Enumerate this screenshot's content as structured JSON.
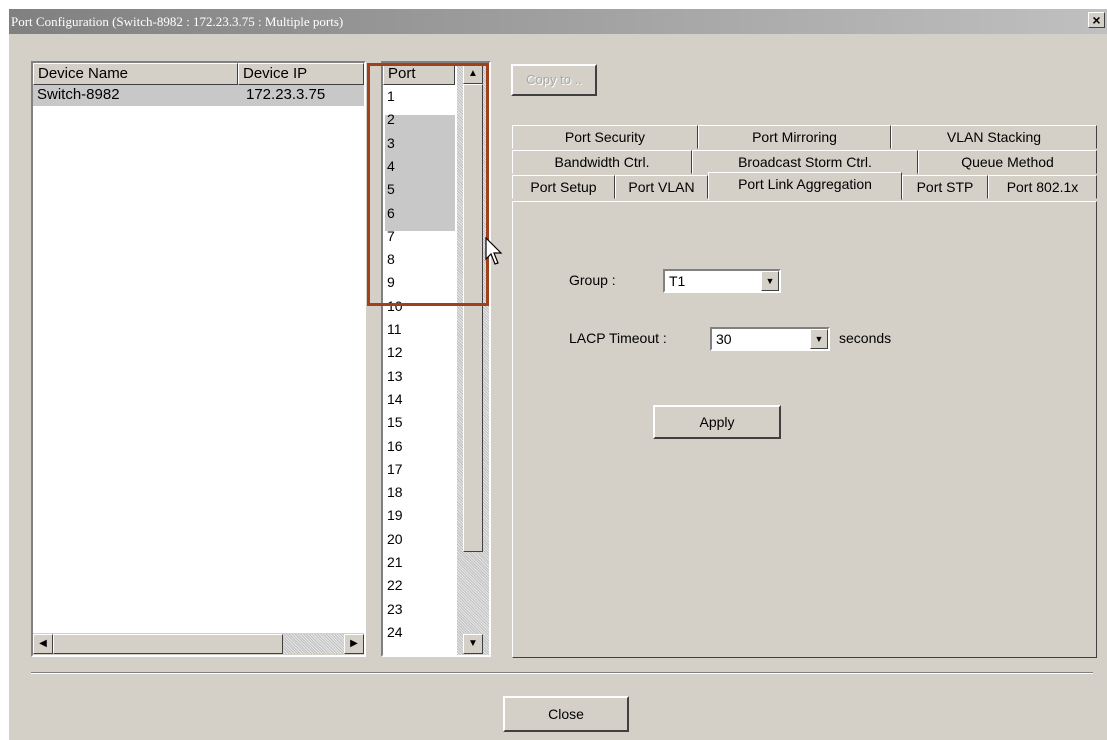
{
  "window": {
    "title": "Port Configuration (Switch-8982 : 172.23.3.75 : Multiple ports)",
    "close_glyph": "×"
  },
  "device_table": {
    "headers": [
      "Device Name",
      "Device IP"
    ],
    "rows": [
      {
        "name": "Switch-8982",
        "ip": "172.23.3.75"
      }
    ]
  },
  "port_list": {
    "header": "Port",
    "items": [
      "1",
      "2",
      "3",
      "4",
      "5",
      "6",
      "7",
      "8",
      "9",
      "10",
      "11",
      "12",
      "13",
      "14",
      "15",
      "16",
      "17",
      "18",
      "19",
      "20",
      "21",
      "22",
      "23",
      "24"
    ],
    "selected": [
      "2",
      "3",
      "4",
      "5",
      "6"
    ]
  },
  "copy_button": "Copy to ..",
  "tabs": {
    "row1": [
      "Port Security",
      "Port Mirroring",
      "VLAN Stacking"
    ],
    "row2": [
      "Bandwidth Ctrl.",
      "Broadcast Storm Ctrl.",
      "Queue Method"
    ],
    "row3": [
      "Port Setup",
      "Port VLAN",
      "Port Link Aggregation",
      "Port STP",
      "Port 802.1x"
    ],
    "active": "Port Link Aggregation"
  },
  "form": {
    "group_label": "Group :",
    "group_value": "T1",
    "lacp_label": "LACP Timeout :",
    "lacp_value": "30",
    "lacp_unit": "seconds",
    "apply_label": "Apply"
  },
  "close_label": "Close",
  "colors": {
    "highlight_box": "#a0401c",
    "selection": "#c8c8c8",
    "face": "#d4d0c8"
  }
}
